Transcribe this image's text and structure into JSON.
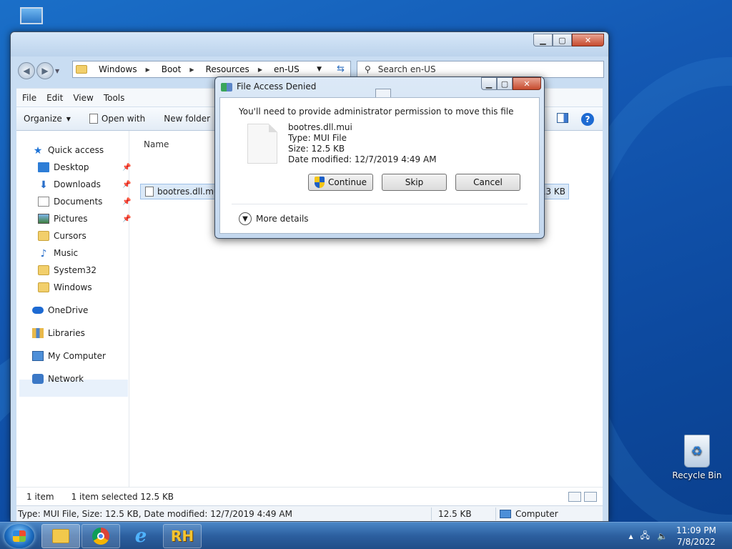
{
  "explorer": {
    "breadcrumb": [
      "Windows",
      "Boot",
      "Resources",
      "en-US"
    ],
    "search_placeholder": "Search en-US",
    "menu": [
      "File",
      "Edit",
      "View",
      "Tools"
    ],
    "toolbar": {
      "organize": "Organize",
      "open_with": "Open with",
      "new_folder": "New folder"
    },
    "nav": {
      "quick_access": "Quick access",
      "items": [
        "Desktop",
        "Downloads",
        "Documents",
        "Pictures",
        "Cursors",
        "Music",
        "System32",
        "Windows"
      ],
      "onedrive": "OneDrive",
      "libraries": "Libraries",
      "my_computer": "My Computer",
      "network": "Network"
    },
    "column_name": "Name",
    "file": {
      "name": "bootres.dll.mui",
      "size": "13 KB"
    },
    "status": {
      "count": "1 item",
      "selected": "1 item selected  12.5 KB"
    },
    "info": {
      "details": "Type: MUI File, Size: 12.5 KB, Date modified: 12/7/2019 4:49 AM",
      "size": "12.5 KB",
      "location": "Computer"
    }
  },
  "dialog": {
    "title": "File Access Denied",
    "message": "You'll need to provide administrator permission to move this file",
    "file_name": "bootres.dll.mui",
    "file_type": "Type: MUI File",
    "file_size": "Size: 12.5 KB",
    "file_date": "Date modified: 12/7/2019 4:49 AM",
    "continue": "Continue",
    "skip": "Skip",
    "cancel": "Cancel",
    "more_details": "More details"
  },
  "desktop": {
    "recycle_bin": "Recycle Bin"
  },
  "taskbar": {
    "time": "11:09 PM",
    "date": "7/8/2022",
    "rh_label": "RH"
  }
}
